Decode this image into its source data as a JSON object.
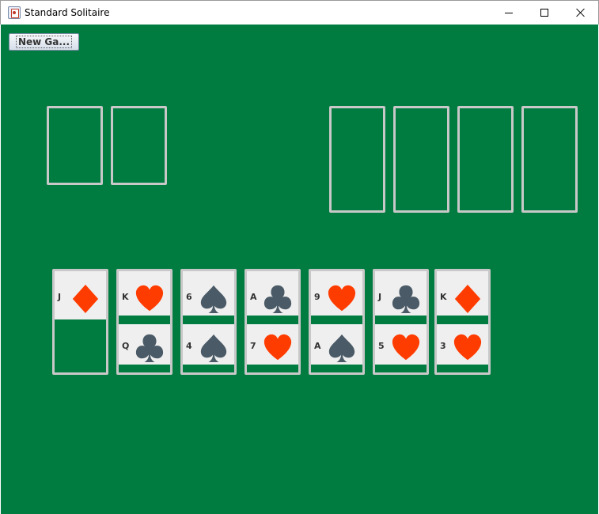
{
  "window": {
    "title": "Standard Solitaire"
  },
  "toolbar": {
    "new_game_label": "New Ga..."
  },
  "colors": {
    "table": "#007c41",
    "red_suit": "#ff3c00",
    "black_suit": "#4a5a66",
    "card_face": "#efefef",
    "slot_border": "#c8c8c8"
  },
  "tableau": [
    {
      "pile": 1,
      "cards": [
        {
          "rank": "J",
          "suit": "diamond"
        }
      ]
    },
    {
      "pile": 2,
      "cards": [
        {
          "rank": "K",
          "suit": "heart"
        },
        {
          "rank": "Q",
          "suit": "club"
        }
      ]
    },
    {
      "pile": 3,
      "cards": [
        {
          "rank": "6",
          "suit": "spade"
        },
        {
          "rank": "4",
          "suit": "spade"
        }
      ]
    },
    {
      "pile": 4,
      "cards": [
        {
          "rank": "A",
          "suit": "club"
        },
        {
          "rank": "7",
          "suit": "heart"
        }
      ]
    },
    {
      "pile": 5,
      "cards": [
        {
          "rank": "9",
          "suit": "heart"
        },
        {
          "rank": "A",
          "suit": "spade"
        }
      ]
    },
    {
      "pile": 6,
      "cards": [
        {
          "rank": "J",
          "suit": "club"
        },
        {
          "rank": "5",
          "suit": "heart"
        }
      ]
    },
    {
      "pile": 7,
      "cards": [
        {
          "rank": "K",
          "suit": "diamond"
        },
        {
          "rank": "3",
          "suit": "heart"
        }
      ]
    }
  ]
}
